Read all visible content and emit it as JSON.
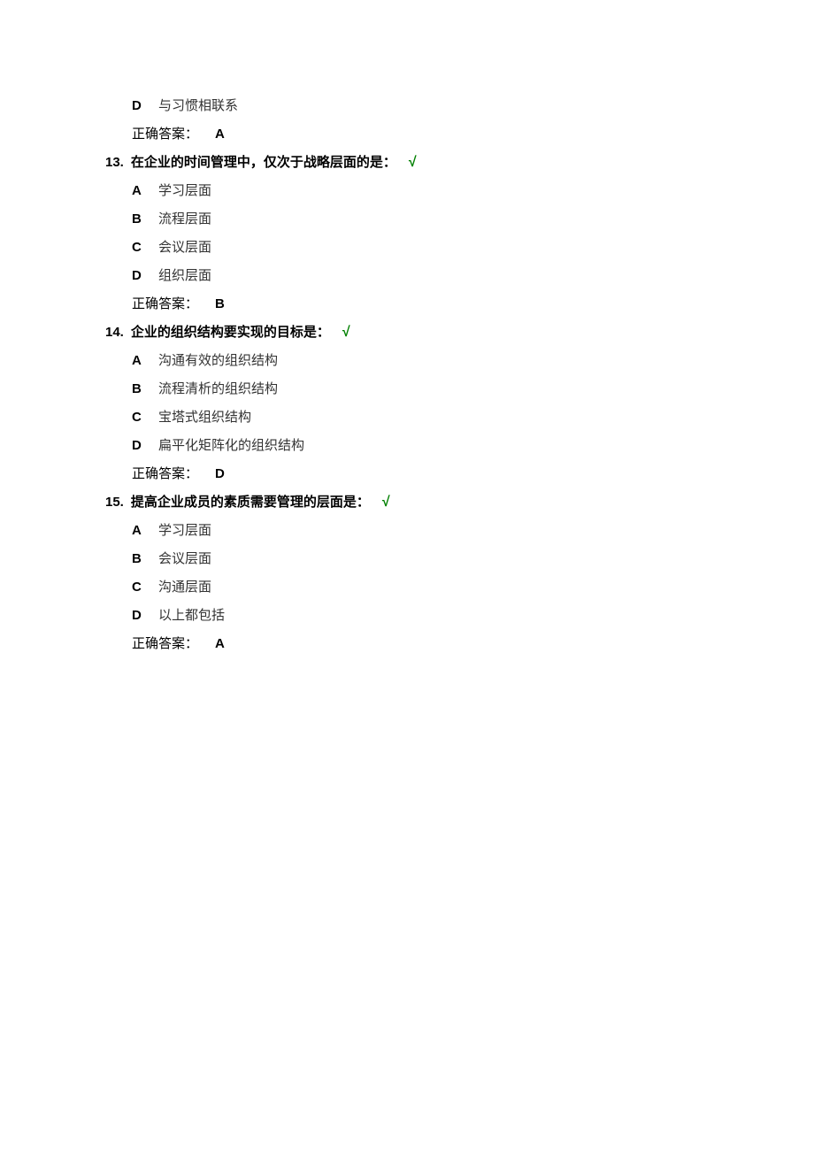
{
  "q12_remainder": {
    "option_d": {
      "letter": "D",
      "text": "与习惯相联系"
    },
    "answer_label": "正确答案：",
    "answer_value": "A"
  },
  "q13": {
    "number": "13.",
    "text": "在企业的时间管理中，仅次于战略层面的是：",
    "check": "√",
    "options": [
      {
        "letter": "A",
        "text": "学习层面"
      },
      {
        "letter": "B",
        "text": "流程层面"
      },
      {
        "letter": "C",
        "text": "会议层面"
      },
      {
        "letter": "D",
        "text": "组织层面"
      }
    ],
    "answer_label": "正确答案：",
    "answer_value": "B"
  },
  "q14": {
    "number": "14.",
    "text": "企业的组织结构要实现的目标是：",
    "check": "√",
    "options": [
      {
        "letter": "A",
        "text": "沟通有效的组织结构"
      },
      {
        "letter": "B",
        "text": "流程清析的组织结构"
      },
      {
        "letter": "C",
        "text": "宝塔式组织结构"
      },
      {
        "letter": "D",
        "text": "扁平化矩阵化的组织结构"
      }
    ],
    "answer_label": "正确答案：",
    "answer_value": "D"
  },
  "q15": {
    "number": "15.",
    "text": "提高企业成员的素质需要管理的层面是：",
    "check": "√",
    "options": [
      {
        "letter": "A",
        "text": "学习层面"
      },
      {
        "letter": "B",
        "text": "会议层面"
      },
      {
        "letter": "C",
        "text": "沟通层面"
      },
      {
        "letter": "D",
        "text": "以上都包括"
      }
    ],
    "answer_label": "正确答案：",
    "answer_value": "A"
  }
}
